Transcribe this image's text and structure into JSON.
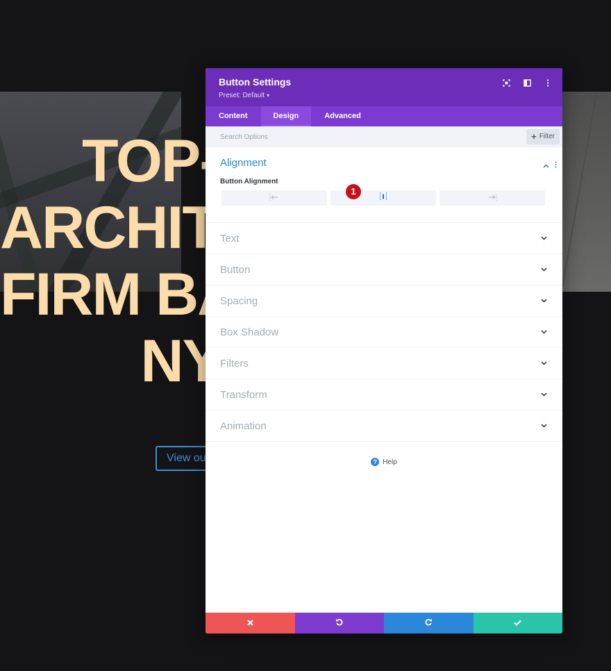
{
  "background": {
    "hero_heading_lines": [
      "TOP-N",
      "ARCHITE",
      "FIRM BA",
      "NY"
    ],
    "hero_button_label": "View ou",
    "heading_color": "#fcdcaa",
    "button_color": "#3f8ed8"
  },
  "modal": {
    "title": "Button Settings",
    "preset_label": "Preset: Default",
    "header_icons": [
      "expand-icon",
      "split-view-icon",
      "more-vertical-icon"
    ],
    "tabs": [
      {
        "label": "Content",
        "active": false
      },
      {
        "label": "Design",
        "active": true
      },
      {
        "label": "Advanced",
        "active": false
      }
    ],
    "search": {
      "placeholder": "Search Options",
      "value": ""
    },
    "filter_label": "Filter",
    "open_section": {
      "title": "Alignment",
      "field_label": "Button Alignment",
      "options": [
        {
          "name": "left",
          "icon": "align-left-icon",
          "selected": false
        },
        {
          "name": "center",
          "icon": "align-center-icon",
          "selected": true
        },
        {
          "name": "right",
          "icon": "align-right-icon",
          "selected": false
        }
      ],
      "badge": "1"
    },
    "sections": [
      {
        "title": "Text"
      },
      {
        "title": "Button"
      },
      {
        "title": "Spacing"
      },
      {
        "title": "Box Shadow"
      },
      {
        "title": "Filters"
      },
      {
        "title": "Transform"
      },
      {
        "title": "Animation"
      }
    ],
    "help_label": "Help",
    "footer": {
      "cancel": "close-icon",
      "undo": "undo-icon",
      "redo": "redo-icon",
      "save": "check-icon"
    },
    "colors": {
      "header": "#6c2eb9",
      "tabs": "#7b3bd0",
      "accent": "#2b87da",
      "cancel": "#ef5555",
      "undo": "#7e3bd0",
      "redo": "#2b87da",
      "save": "#29c4a9"
    }
  }
}
